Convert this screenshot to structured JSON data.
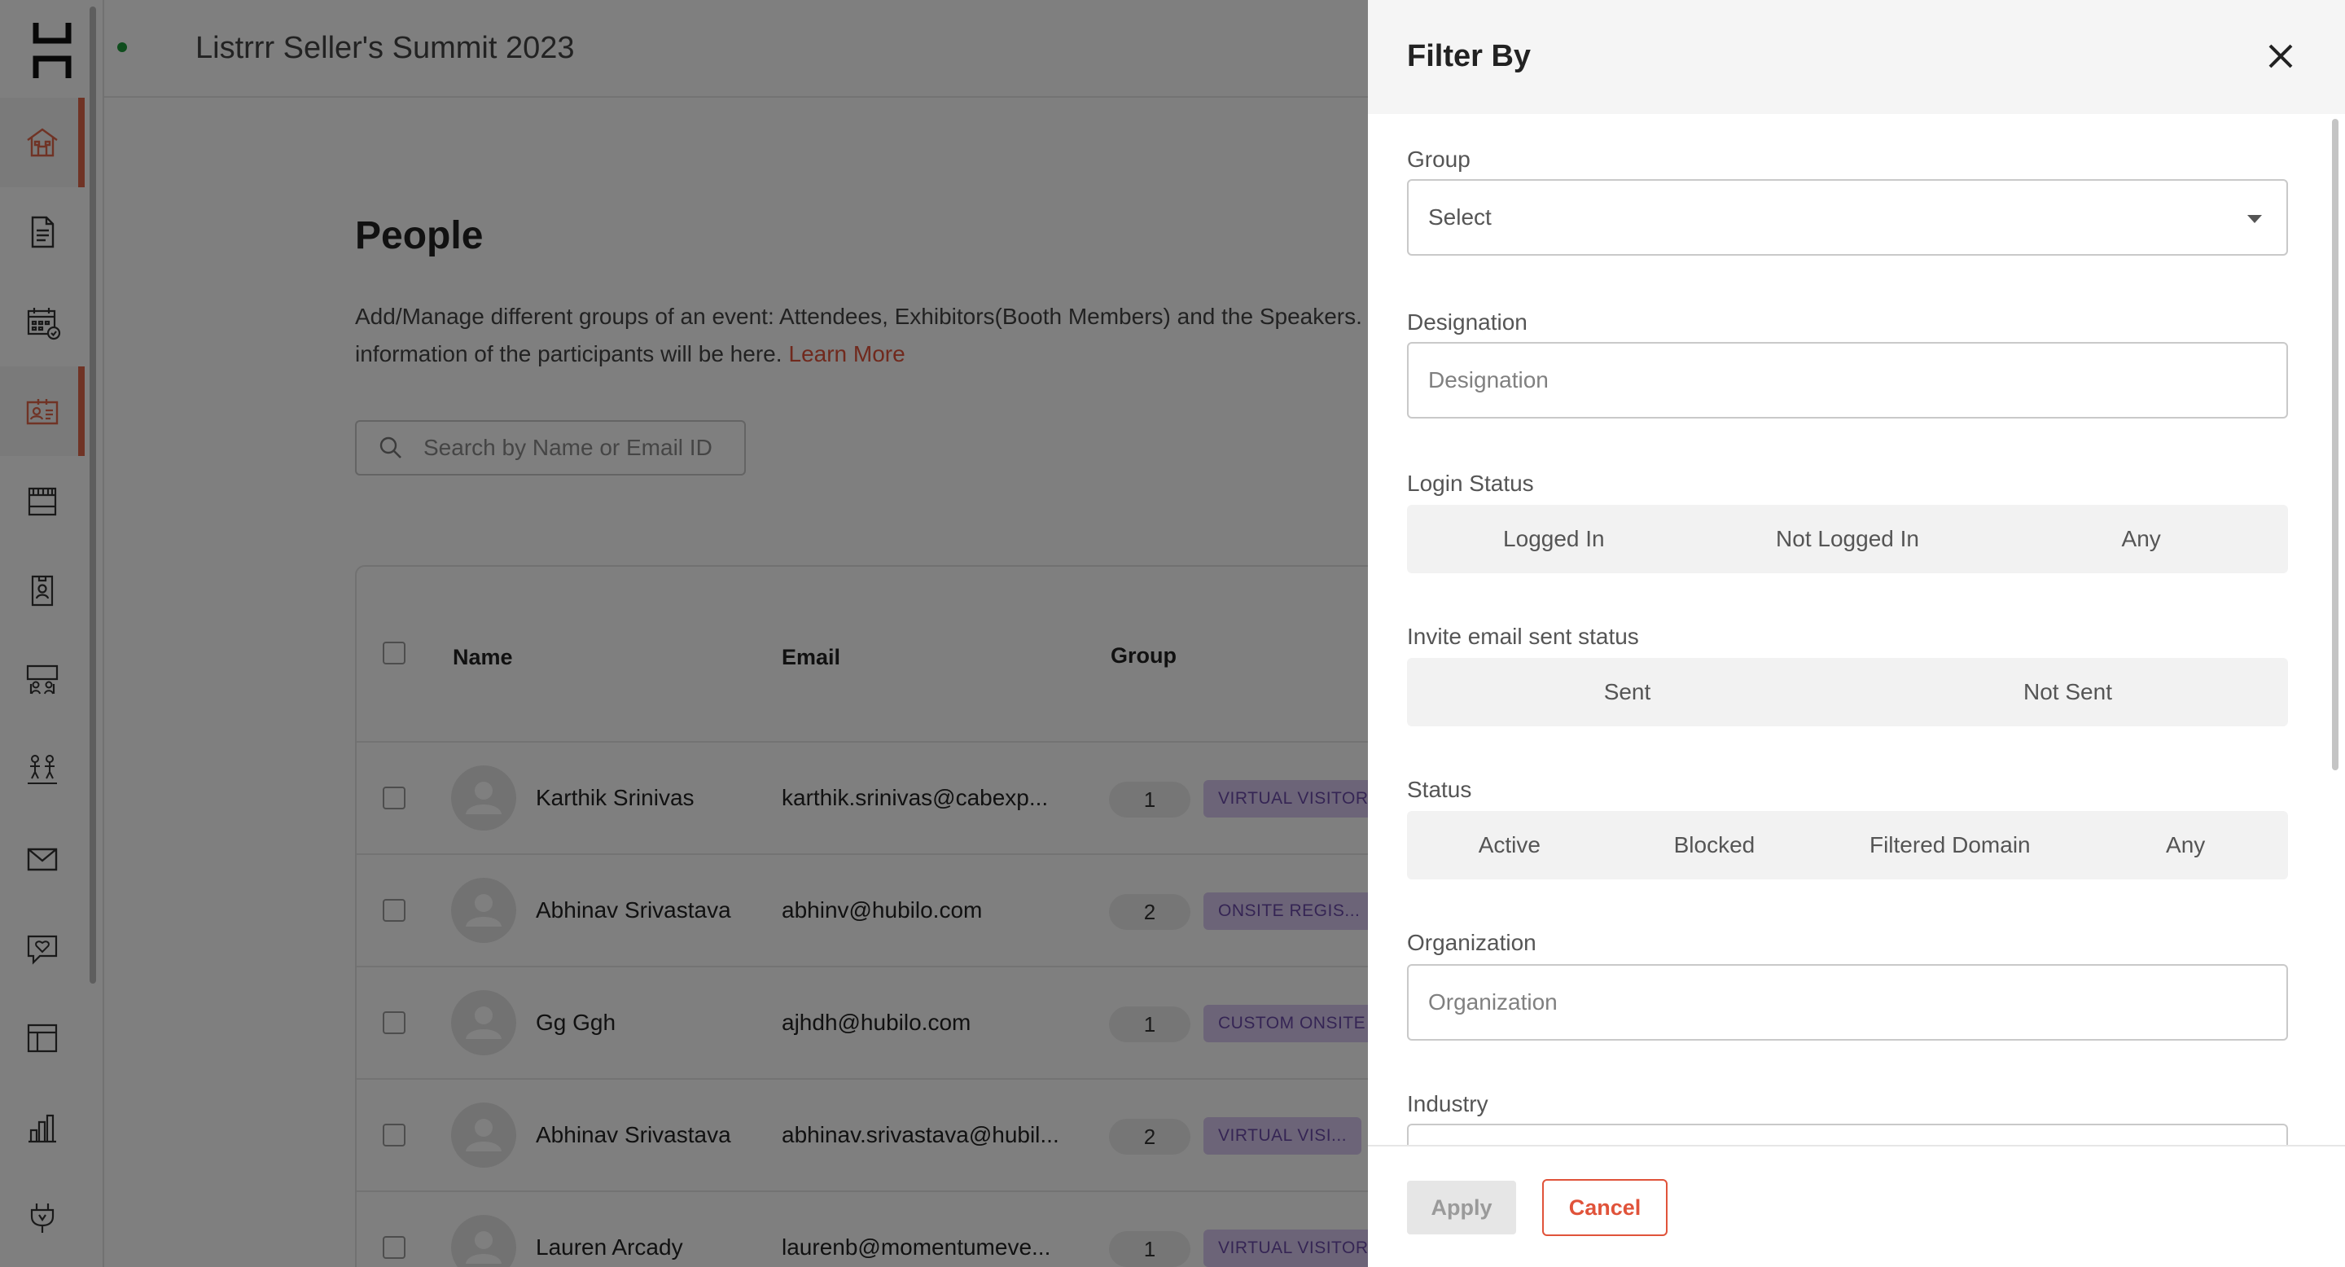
{
  "app": {
    "event_title": "Listrrr Seller's Summit 2023"
  },
  "sidebar": {
    "items": [
      {
        "icon": "home-icon",
        "active": true
      },
      {
        "icon": "document-icon",
        "active": false
      },
      {
        "icon": "calendar-icon",
        "active": false
      },
      {
        "icon": "people-id-icon",
        "active": true
      },
      {
        "icon": "booth-icon",
        "active": false
      },
      {
        "icon": "badge-icon",
        "active": false
      },
      {
        "icon": "sessions-icon",
        "active": false
      },
      {
        "icon": "networking-icon",
        "active": false
      },
      {
        "icon": "mail-icon",
        "active": false
      },
      {
        "icon": "engagement-icon",
        "active": false
      },
      {
        "icon": "layout-icon",
        "active": false
      },
      {
        "icon": "analytics-icon",
        "active": false
      },
      {
        "icon": "integrations-icon",
        "active": false
      }
    ]
  },
  "page": {
    "title": "People",
    "description": "Add/Manage different groups of an event: Attendees, Exhibitors(Booth Members) and the Speakers. every information of the participants will be here.",
    "learn_more": "Learn More",
    "search_placeholder": "Search by Name or Email ID"
  },
  "table": {
    "columns": [
      "Name",
      "Email",
      "Group"
    ],
    "rows": [
      {
        "name": "Karthik Srinivas",
        "email": "karthik.srinivas@cabexp...",
        "group_count": "1",
        "group_badge": "VIRTUAL VISITOR"
      },
      {
        "name": "Abhinav Srivastava",
        "email": "abhinv@hubilo.com",
        "group_count": "2",
        "group_badge": "ONSITE REGIS..."
      },
      {
        "name": "Gg Ggh",
        "email": "ajhdh@hubilo.com",
        "group_count": "1",
        "group_badge": "CUSTOM ONSITE"
      },
      {
        "name": "Abhinav Srivastava",
        "email": "abhinav.srivastava@hubil...",
        "group_count": "2",
        "group_badge": "VIRTUAL VISI..."
      },
      {
        "name": "Lauren Arcady",
        "email": "laurenb@momentumeve...",
        "group_count": "1",
        "group_badge": "VIRTUAL VISITOR"
      }
    ]
  },
  "filter": {
    "title": "Filter By",
    "group_label": "Group",
    "group_value": "Select",
    "designation_label": "Designation",
    "designation_placeholder": "Designation",
    "login_status_label": "Login Status",
    "login_status_options": [
      "Logged In",
      "Not Logged In",
      "Any"
    ],
    "invite_label": "Invite email sent status",
    "invite_options": [
      "Sent",
      "Not Sent"
    ],
    "status_label": "Status",
    "status_options": [
      "Active",
      "Blocked",
      "Filtered Domain",
      "Any"
    ],
    "organization_label": "Organization",
    "organization_placeholder": "Organization",
    "industry_label": "Industry",
    "apply_label": "Apply",
    "cancel_label": "Cancel"
  },
  "colors": {
    "accent": "#e0533a",
    "active_bar": "#e0664a",
    "badge_bg": "#d9c9f0",
    "badge_text": "#6a4aa8",
    "online_dot": "#1e9b3a"
  }
}
